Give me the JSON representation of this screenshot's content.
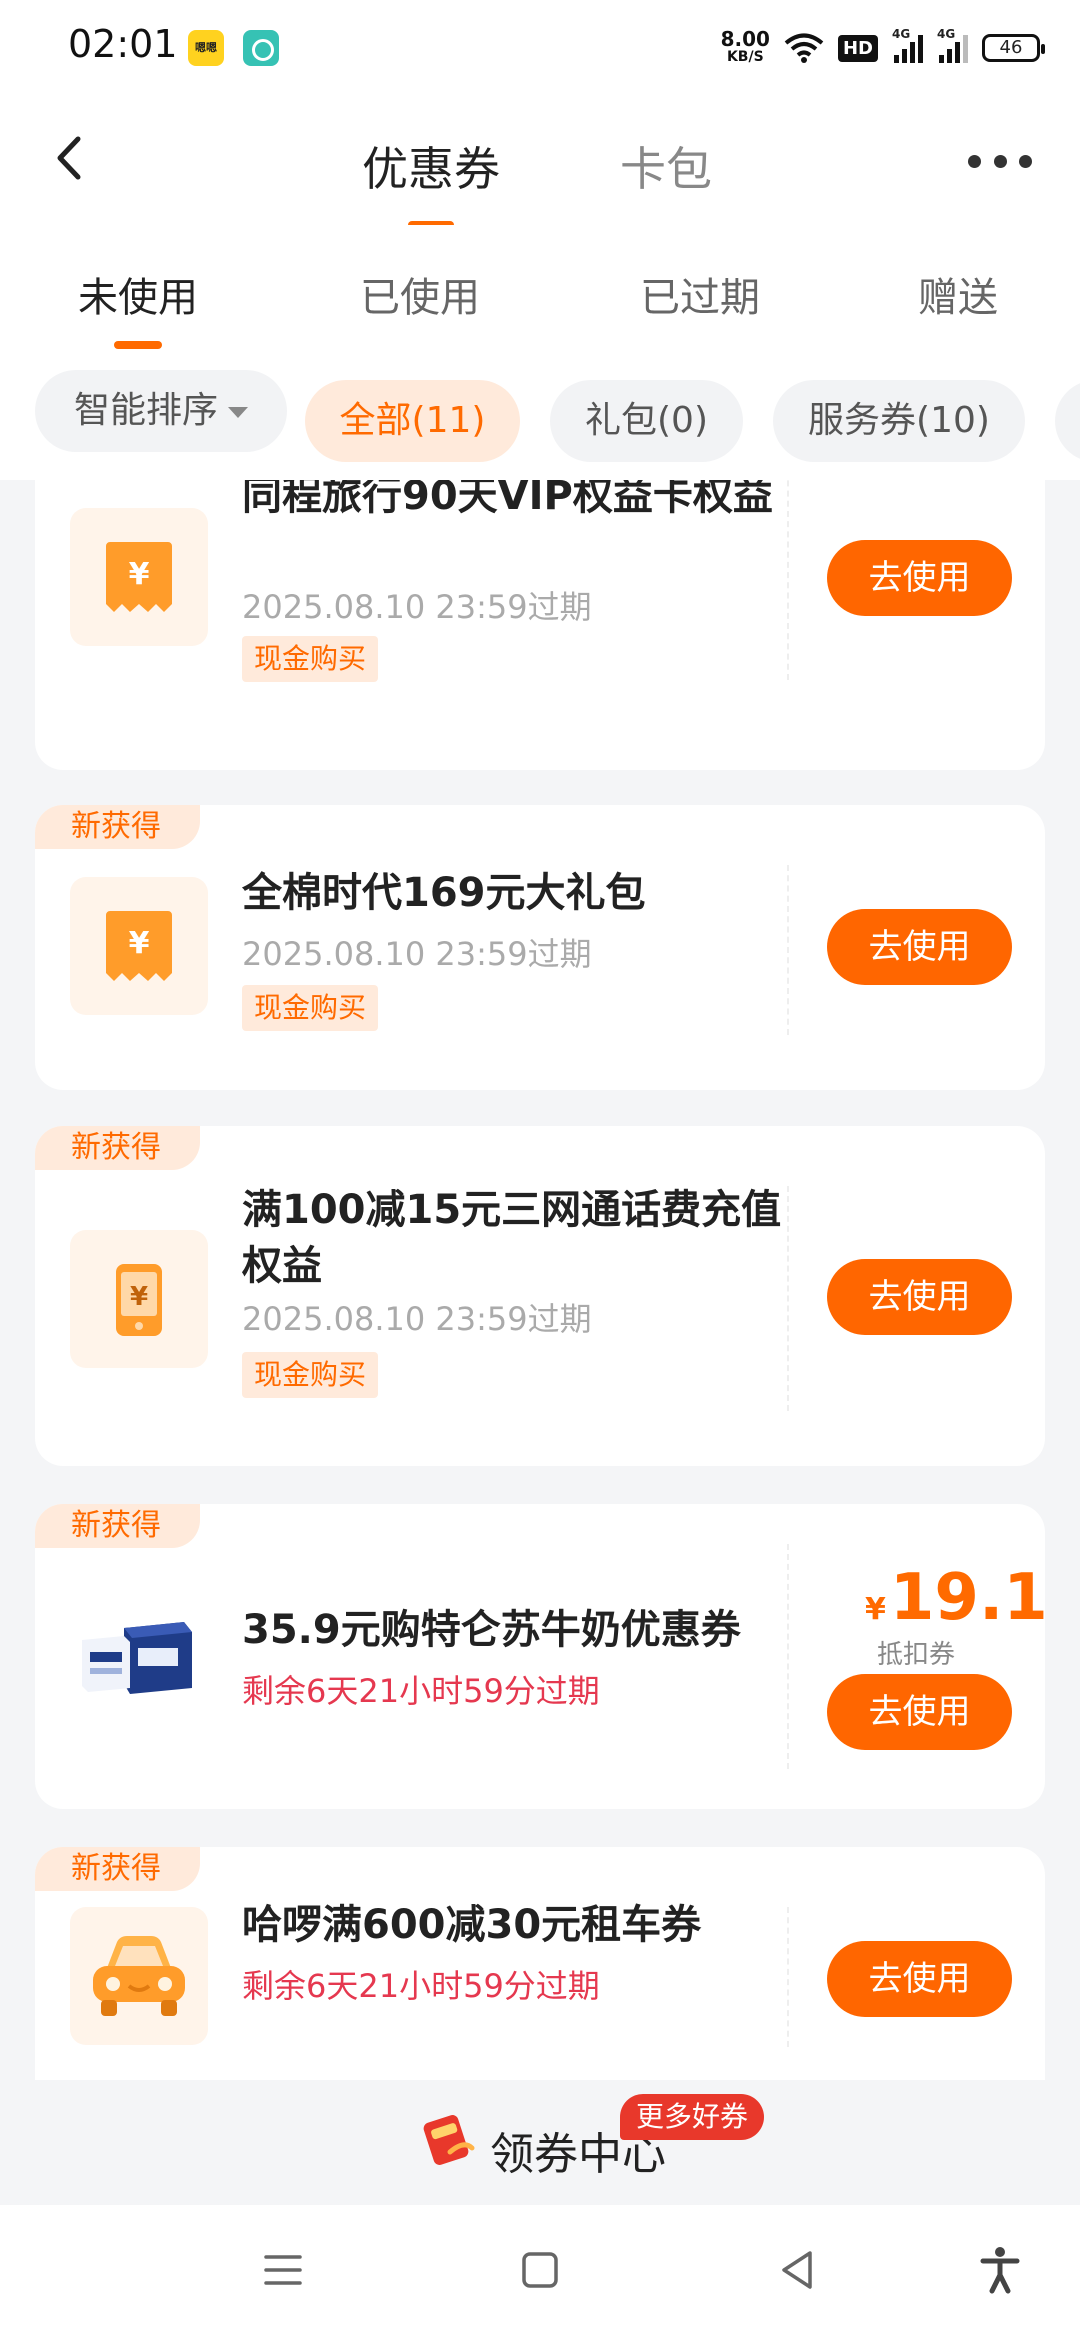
{
  "status_bar": {
    "time": "02:01",
    "app_icon_1_label": "嗯嗯",
    "net_speed": "8.00",
    "net_unit": "KB/S",
    "hd": "HD",
    "sig1": "4G",
    "sig2": "4G",
    "battery": "46"
  },
  "header": {
    "tabs": [
      {
        "label": "优惠券",
        "active": true
      },
      {
        "label": "卡包",
        "active": false
      }
    ]
  },
  "subtabs": [
    {
      "label": "未使用",
      "active": true
    },
    {
      "label": "已使用"
    },
    {
      "label": "已过期"
    },
    {
      "label": "赠送"
    }
  ],
  "filters": {
    "sort_label": "智能排序",
    "chips": [
      {
        "label": "全部(11)",
        "active": true
      },
      {
        "label": "礼包(0)"
      },
      {
        "label": "服务券(10)"
      }
    ]
  },
  "coupons": [
    {
      "title": "同程旅行90天VIP权益卡权益",
      "expire": "2025.08.10 23:59过期",
      "tag": "现金购买",
      "button": "去使用",
      "icon": "ticket-icon"
    },
    {
      "badge": "新获得",
      "title": "全棉时代169元大礼包",
      "expire": "2025.08.10 23:59过期",
      "tag": "现金购买",
      "button": "去使用",
      "icon": "ticket-icon"
    },
    {
      "badge": "新获得",
      "title": "满100减15元三网通话费充值权益",
      "expire": "2025.08.10 23:59过期",
      "tag": "现金购买",
      "button": "去使用",
      "icon": "phone-recharge-icon"
    },
    {
      "badge": "新获得",
      "title": "35.9元购特仑苏牛奶优惠券",
      "expire": "剩余6天21小时59分过期",
      "amount_symbol": "¥",
      "amount": "19.1",
      "amount_label": "抵扣券",
      "button": "去使用",
      "icon": "milk-product-image"
    },
    {
      "badge": "新获得",
      "title": "哈啰满600减30元租车券",
      "expire": "剩余6天21小时59分过期",
      "button": "去使用",
      "icon": "car-icon"
    }
  ],
  "coupon_center": {
    "label": "领券中心",
    "badge": "更多好券"
  },
  "colors": {
    "accent": "#ff6600",
    "tag_bg": "#ffeadb",
    "expire_red": "#e5384f"
  }
}
